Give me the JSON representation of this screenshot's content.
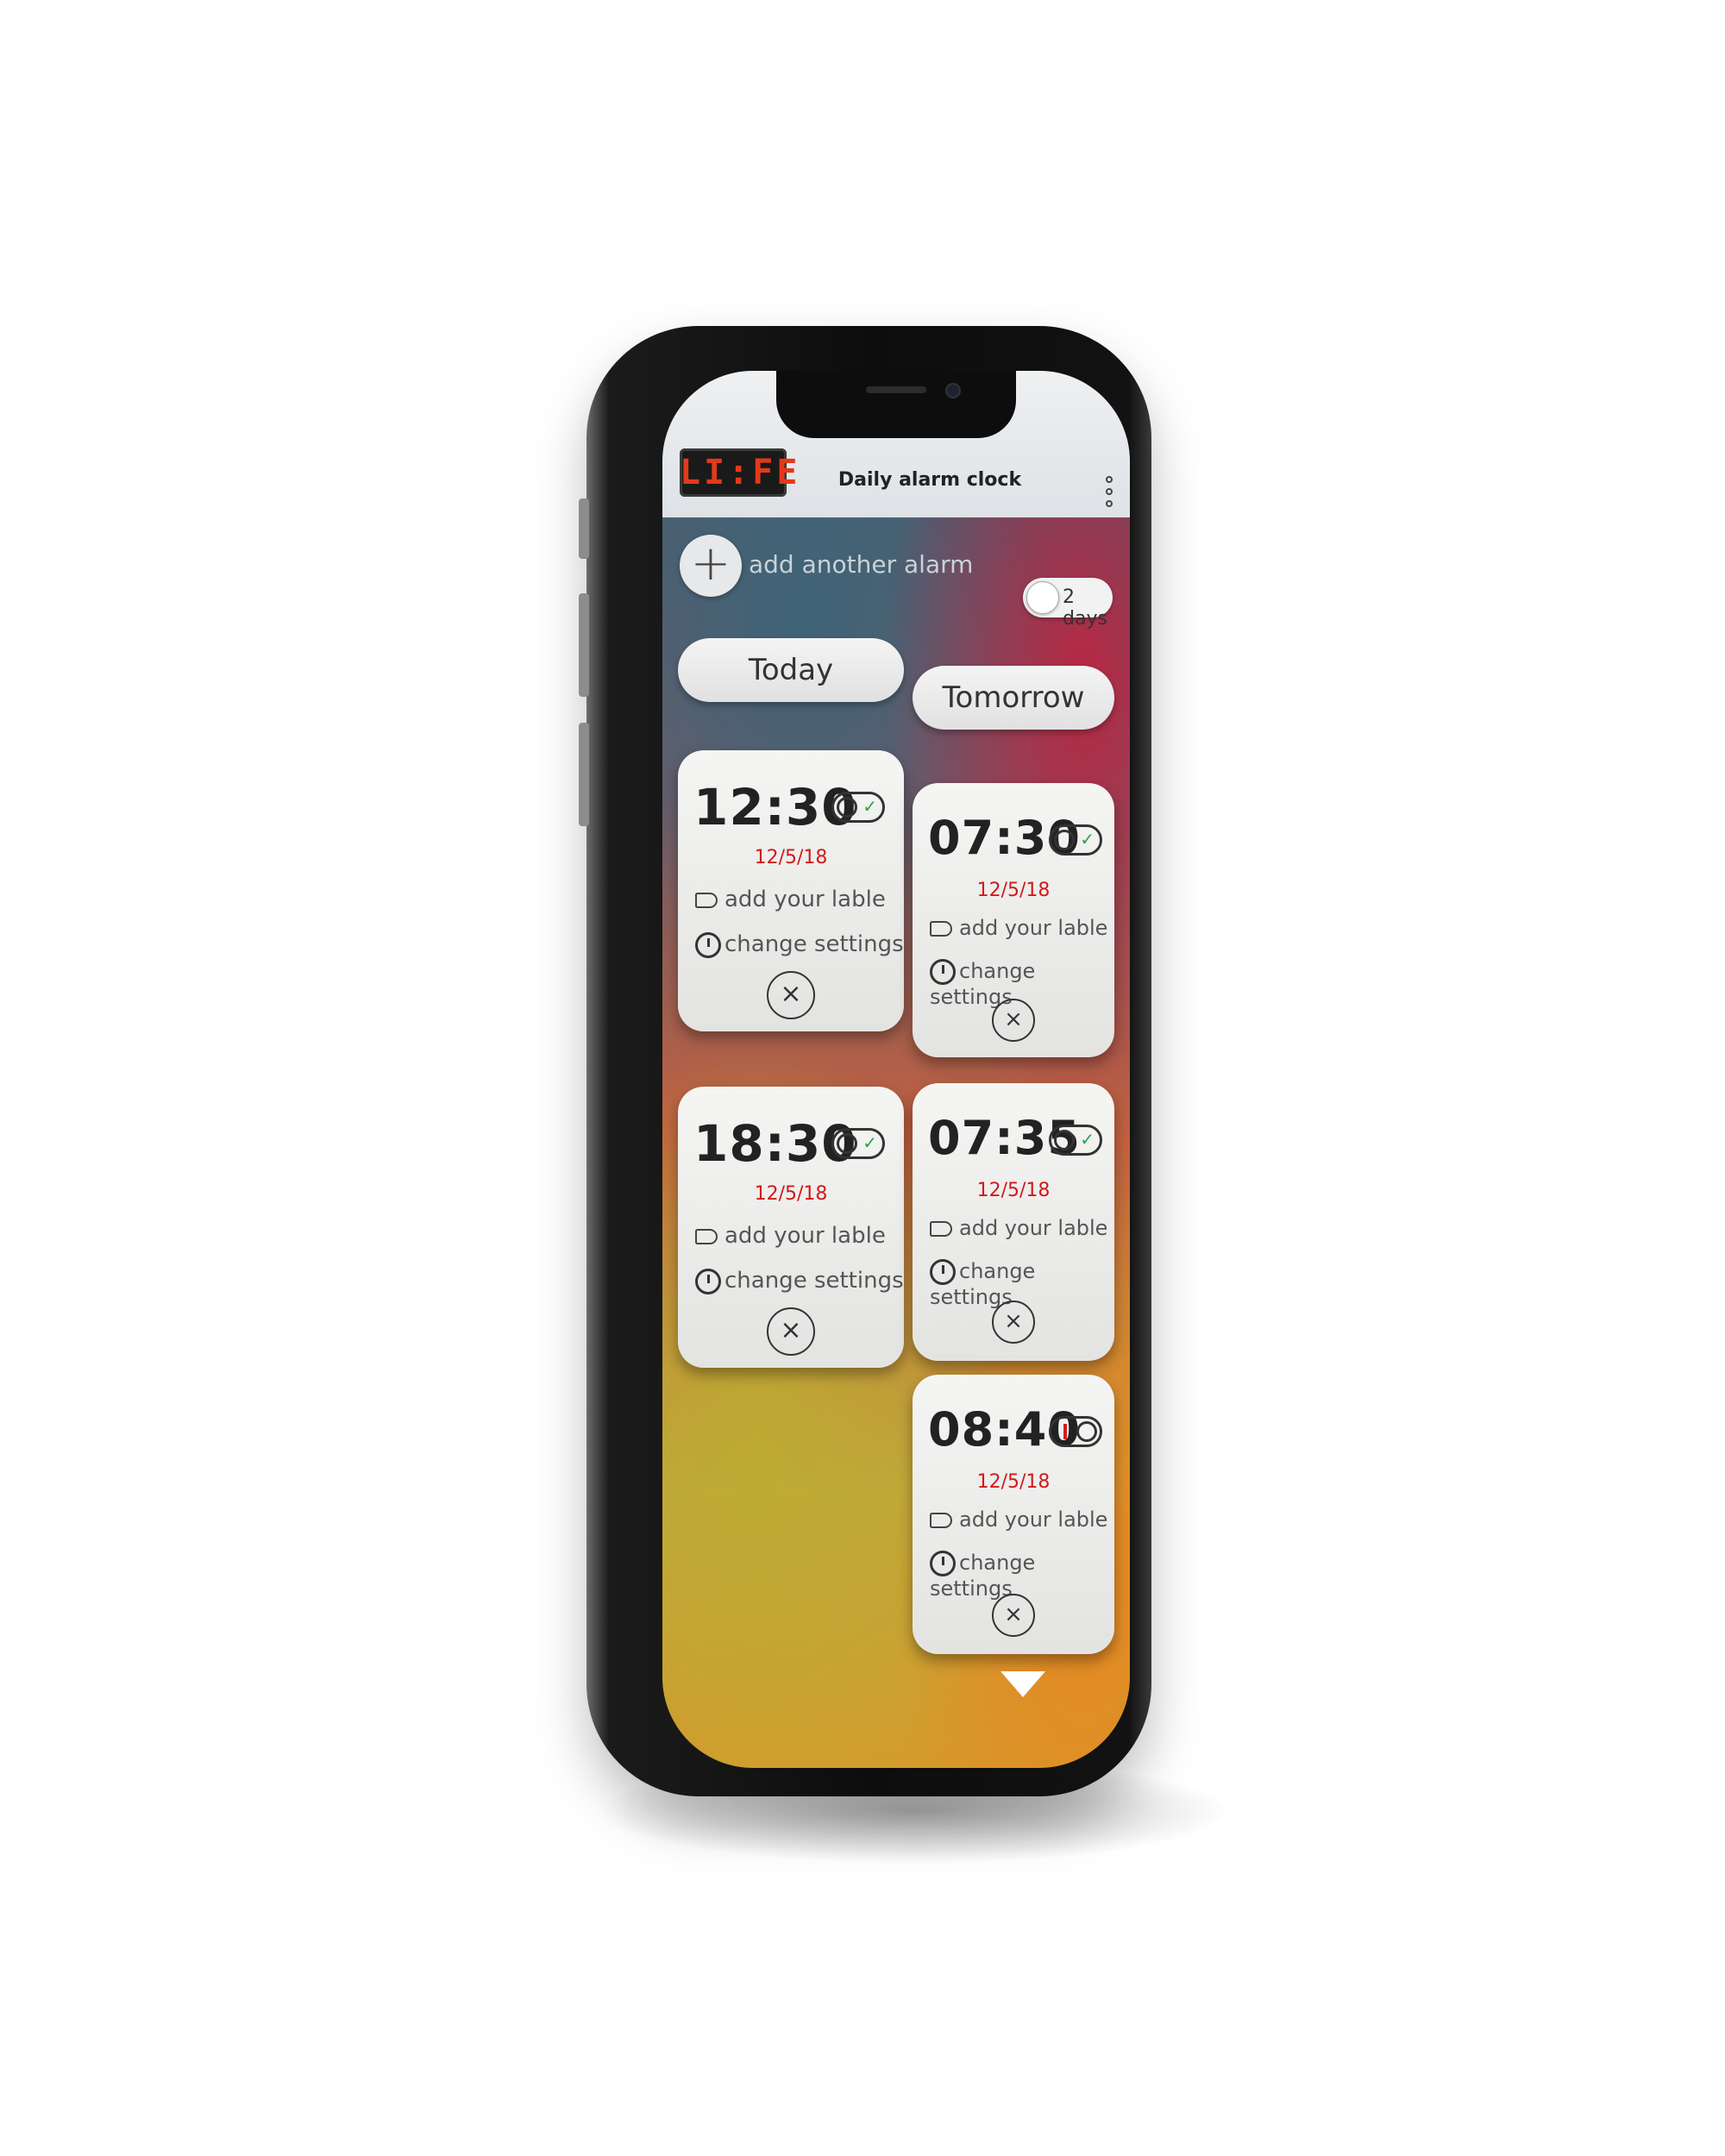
{
  "header": {
    "logo_text": "LI:FE",
    "title": "Daily alarm clock",
    "more_icon": "vertical-ellipsis-icon"
  },
  "add_alarm": {
    "icon": "+",
    "label": "add another alarm"
  },
  "days_toggle": {
    "label": "2 days",
    "on": false
  },
  "columns": [
    {
      "label": "Today"
    },
    {
      "label": "Tomorrow"
    }
  ],
  "alarms": {
    "today": [
      {
        "time": "12:30",
        "date": "12/5/18",
        "enabled": true,
        "label": "add your lable",
        "settings": "change settings",
        "remove": "×"
      },
      {
        "time": "18:30",
        "date": "12/5/18",
        "enabled": true,
        "label": "add your lable",
        "settings": "change settings",
        "remove": "×"
      }
    ],
    "tomorrow": [
      {
        "time": "07:30",
        "date": "12/5/18",
        "enabled": true,
        "label": "add your lable",
        "settings": "change settings",
        "remove": "×"
      },
      {
        "time": "07:35",
        "date": "12/5/18",
        "enabled": true,
        "label": "add your lable",
        "settings": "change settings",
        "remove": "×"
      },
      {
        "time": "08:40",
        "date": "12/5/18",
        "enabled": false,
        "label": "add your lable",
        "settings": "change settings",
        "remove": "×"
      }
    ]
  },
  "colors": {
    "date_red": "#d21a1a",
    "check_green": "#2aa24a",
    "logo_red": "#e23a1a"
  }
}
